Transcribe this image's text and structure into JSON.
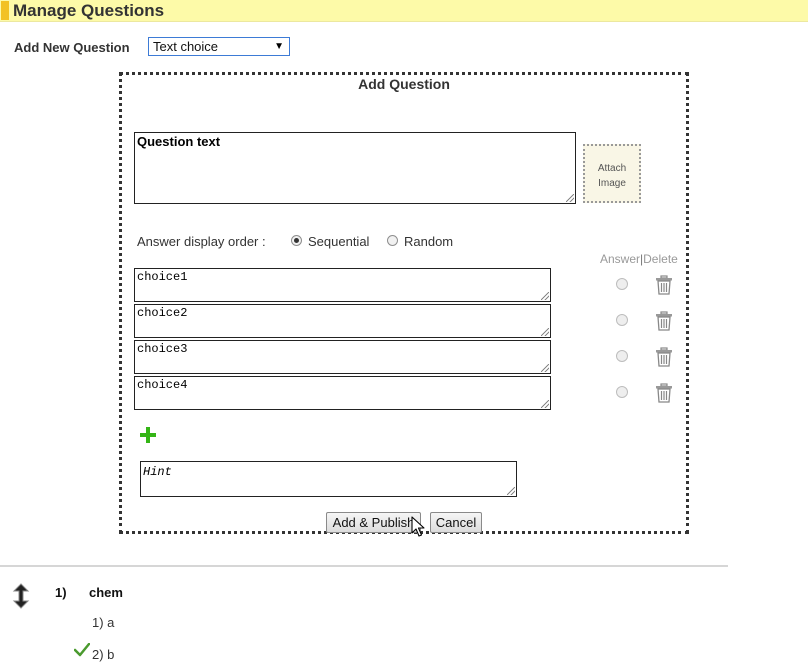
{
  "header": {
    "title": "Manage Questions"
  },
  "add_new": {
    "label": "Add New Question",
    "selected_type": "Text choice"
  },
  "panel": {
    "title": "Add Question",
    "question_placeholder": "Question text",
    "attach_line1": "Attach",
    "attach_line2": "Image",
    "order_label": "Answer display order :",
    "order_options": [
      "Sequential",
      "Random"
    ],
    "order_selected": "Sequential",
    "answer_header": "Answer",
    "delete_header": "Delete",
    "choices": [
      "choice1",
      "choice2",
      "choice3",
      "choice4"
    ],
    "hint_placeholder": "Hint",
    "add_publish_label": "Add & Publish",
    "cancel_label": "Cancel"
  },
  "questions": [
    {
      "number": "1)",
      "title": "chem",
      "answers": [
        {
          "label": "1) a",
          "correct": false
        },
        {
          "label": "2) b",
          "correct": true
        }
      ]
    }
  ],
  "colors": {
    "header_bg": "#fdfaa8",
    "header_accent": "#f2c224",
    "add_icon": "#34b516",
    "correct_check": "#4a9a2e"
  },
  "icons": {
    "add": "plus-icon",
    "delete": "trash-icon",
    "move": "move-vertical-icon",
    "correct": "checkmark-icon",
    "cursor": "mouse-cursor-icon"
  }
}
